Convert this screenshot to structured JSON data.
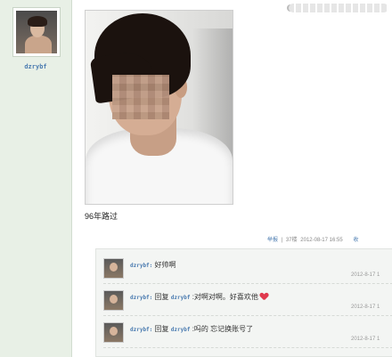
{
  "author": {
    "name": "dzrybf"
  },
  "post": {
    "caption": "96年路过",
    "meta": {
      "report": "举报",
      "separator": "|",
      "floor": "37楼",
      "time": "2012-08-17 16:55",
      "fav": "收"
    }
  },
  "comments": [
    {
      "user": "dzrybf:",
      "reply_word": "",
      "target": "",
      "text": "好帅啊",
      "time": "2012-8-17 1",
      "emoji": ""
    },
    {
      "user": "dzrybf:",
      "reply_word": "回复",
      "target": "dzrybf",
      "text": ":对啊对啊。好喜欢他",
      "time": "2012-8-17 1",
      "emoji": "heart-icon"
    },
    {
      "user": "dzrybf:",
      "reply_word": "回复",
      "target": "dzrybf",
      "text": ":吗的 忘记换账号了",
      "time": "2012-8-17 1",
      "emoji": ""
    }
  ]
}
